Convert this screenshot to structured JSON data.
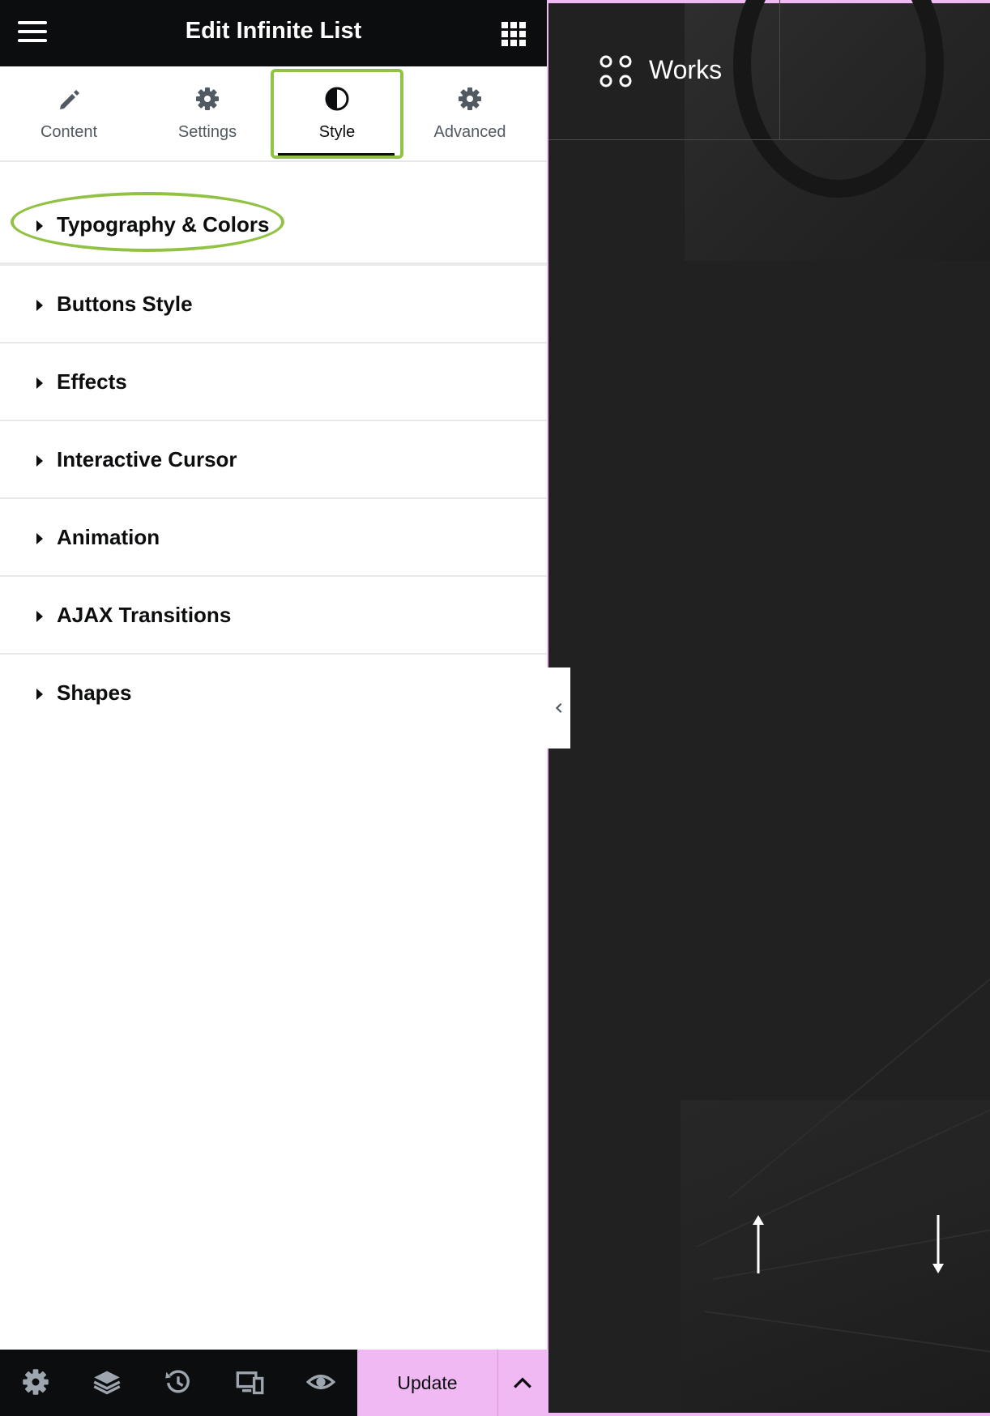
{
  "panel": {
    "title": "Edit Infinite List",
    "tabs": [
      {
        "label": "Content",
        "icon": "pencil-icon"
      },
      {
        "label": "Settings",
        "icon": "gear-icon"
      },
      {
        "label": "Style",
        "icon": "half-circle-icon",
        "active": true
      },
      {
        "label": "Advanced",
        "icon": "gear-icon"
      }
    ],
    "sections": [
      {
        "label": "Typography & Colors",
        "highlighted": true
      },
      {
        "label": "Buttons Style"
      },
      {
        "label": "Effects"
      },
      {
        "label": "Interactive Cursor"
      },
      {
        "label": "Animation"
      },
      {
        "label": "AJAX Transitions"
      },
      {
        "label": "Shapes"
      }
    ],
    "footer": {
      "icons": [
        "gear-icon",
        "layers-icon",
        "history-icon",
        "responsive-icon",
        "eye-icon"
      ],
      "update_label": "Update"
    }
  },
  "preview": {
    "menu_label": "Works"
  },
  "colors": {
    "highlight": "#92c244",
    "update_button": "#f0b9f4",
    "topbar": "#0c0d0e",
    "preview_bg": "#212121"
  }
}
